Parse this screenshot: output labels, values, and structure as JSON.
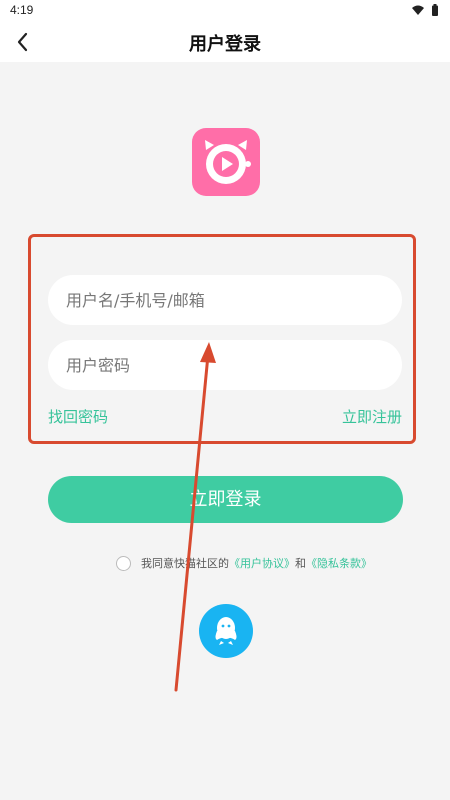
{
  "status_bar": {
    "time": "4:19"
  },
  "header": {
    "title": "用户登录"
  },
  "form": {
    "username_placeholder": "用户名/手机号/邮箱",
    "password_placeholder": "用户密码",
    "forgot_label": "找回密码",
    "register_label": "立即注册",
    "login_label": "立即登录"
  },
  "agreement": {
    "prefix": "我同意快猫社区的",
    "user_agreement": "《用户协议》",
    "and": "和",
    "privacy_policy": "《隐私条款》"
  },
  "icons": {
    "back": "chevron-left-icon",
    "logo": "cat-play-logo",
    "social": "qq-icon"
  },
  "colors": {
    "accent": "#3fcca2",
    "link": "#36c39a",
    "logo": "#ff6ea8",
    "qq": "#19b4f2",
    "annotation": "#d84a2f"
  }
}
